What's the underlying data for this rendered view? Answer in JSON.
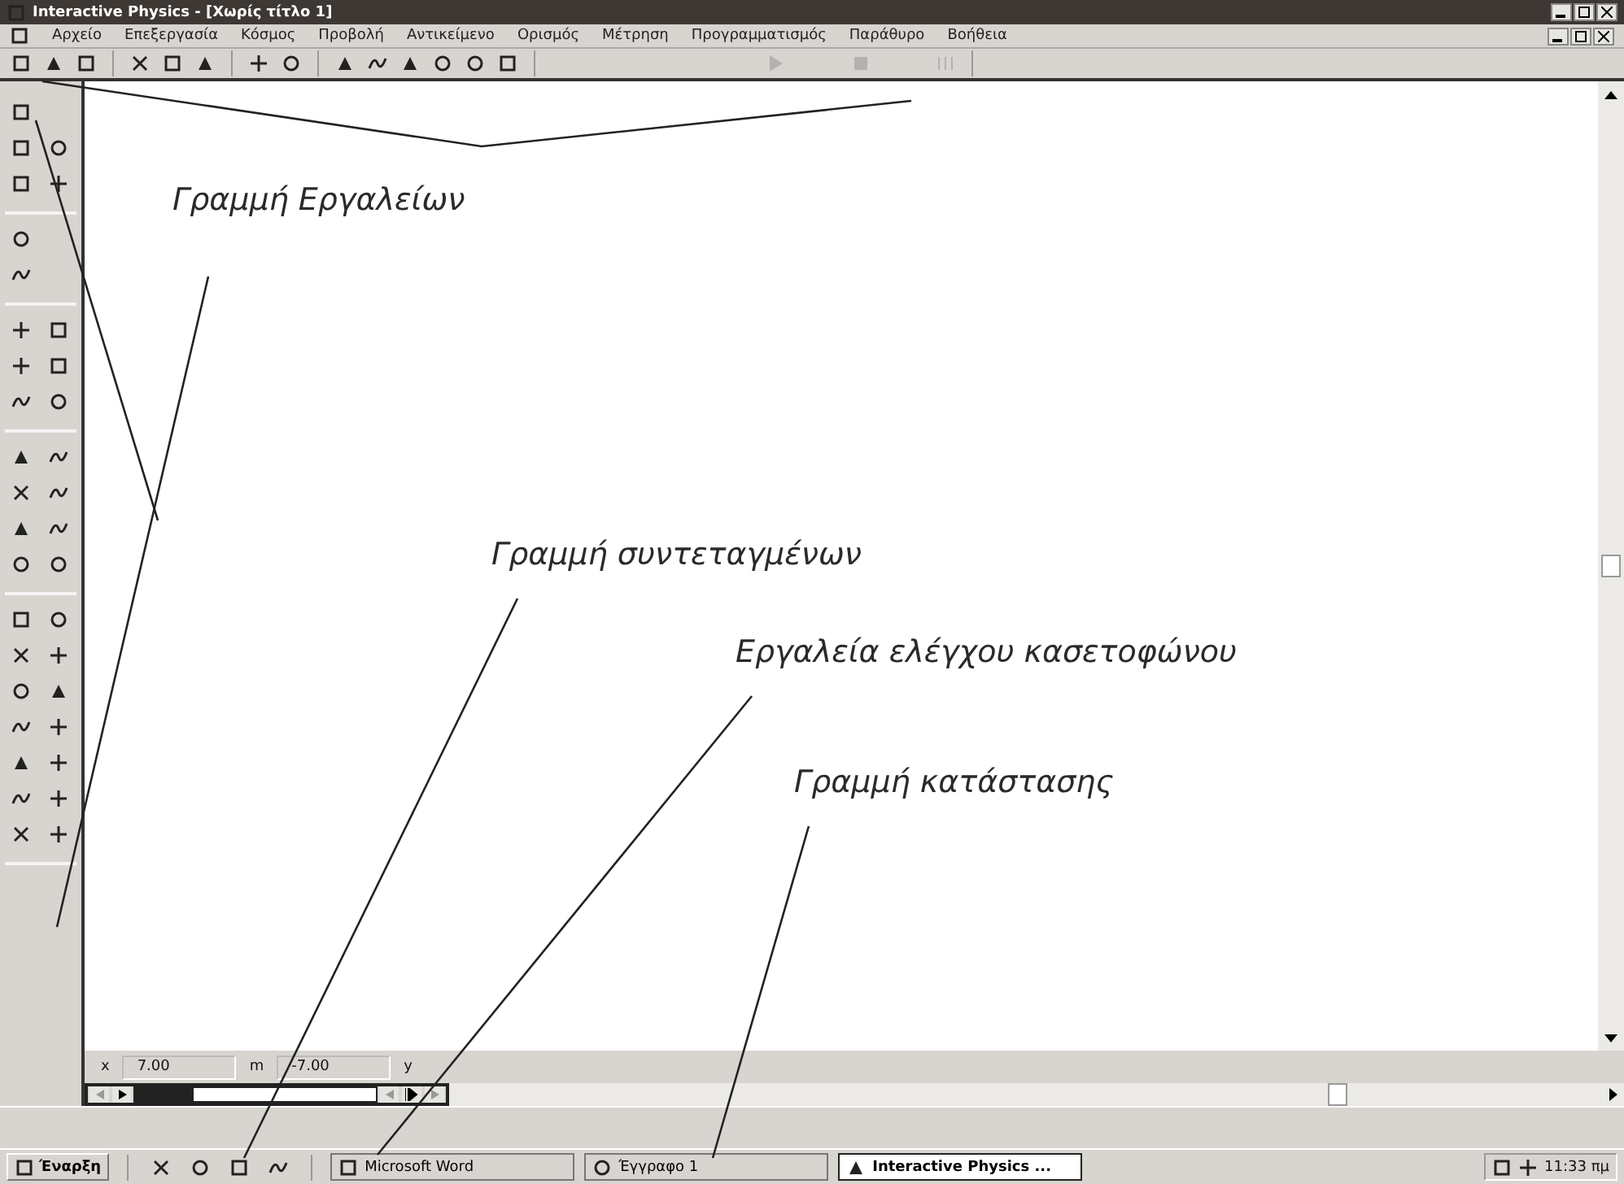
{
  "window": {
    "title": "Interactive Physics - [Χωρίς τίτλο 1]"
  },
  "menu": [
    "Αρχείο",
    "Επεξεργασία",
    "Κόσμος",
    "Προβολή",
    "Αντικείμενο",
    "Ορισμός",
    "Μέτρηση",
    "Προγραμματισμός",
    "Παράθυρο",
    "Βοήθεια"
  ],
  "tape": {
    "level": 0.24
  },
  "coordinates": {
    "x_label": "x",
    "x_value": "7.00",
    "x_unit": "m",
    "y_value": "-7.00",
    "y_label": "y"
  },
  "annotations": [
    {
      "kind": "toolbar",
      "text": "Γραμμή Εργαλείων"
    },
    {
      "kind": "coords",
      "text": "Γραμμή συντεταγμένων"
    },
    {
      "kind": "tape",
      "text": "Εργαλεία ελέγχου κασετοφώνου"
    },
    {
      "kind": "status",
      "text": "Γραμμή κατάστασης"
    }
  ],
  "taskbar": {
    "start": "Έναρξη",
    "tasks": [
      {
        "label": "Microsoft Word",
        "selected": false
      },
      {
        "label": "Έγγραφο 1",
        "selected": false
      },
      {
        "label": "Interactive Physics ...",
        "selected": true
      }
    ],
    "clock": "11:33 πμ"
  }
}
